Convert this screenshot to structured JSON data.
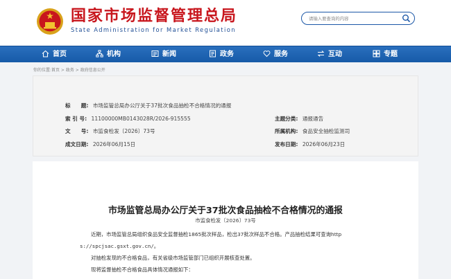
{
  "header": {
    "title": "国家市场监督管理总局",
    "subtitle": "State Administration for Market Regulation",
    "search_placeholder": "请输入要查询的内容"
  },
  "nav": [
    {
      "label": "首页",
      "icon": "home-icon"
    },
    {
      "label": "机构",
      "icon": "org-icon"
    },
    {
      "label": "新闻",
      "icon": "news-icon"
    },
    {
      "label": "政务",
      "icon": "affairs-icon"
    },
    {
      "label": "服务",
      "icon": "heart-icon"
    },
    {
      "label": "互动",
      "icon": "interact-icon"
    },
    {
      "label": "专题",
      "icon": "topic-icon"
    }
  ],
  "breadcrumb": "你的位置:首页 > 政务 > 政府信息公开",
  "info": {
    "title_label": "标　　题:",
    "title_value": "市场监管总局办公厅关于37批次食品抽检不合格情况的通报",
    "index_label": "索 引 号:",
    "index_value": "11100000MB0143028R/2026-915555",
    "category_label": "主题分类:",
    "category_value": "通报通告",
    "docno_label": "文　　号:",
    "docno_value": "市监食检发〔2026〕73号",
    "agency_label": "所属机构:",
    "agency_value": "食品安全抽检监测司",
    "date_label": "成文日期:",
    "date_value": "2026年06月15日",
    "pub_label": "发布日期:",
    "pub_value": "2026年06月23日"
  },
  "article": {
    "title": "市场监管总局办公厅关于37批次食品抽检不合格情况的通报",
    "doc_no": "市监食检发〔2026〕73号",
    "p1": "近期，市场监管总局组织食品安全监督抽检1865批次样品，检出37批次样品不合格。产品抽检结果可查询http",
    "p1b": "s://spcjsac.gsxt.gov.cn/。",
    "p2": "对抽检发现的不合格食品，有关省级市场监管部门已组织开展核查处置。",
    "p3": "现将监督抽检不合格食品具体情况通报如下："
  }
}
